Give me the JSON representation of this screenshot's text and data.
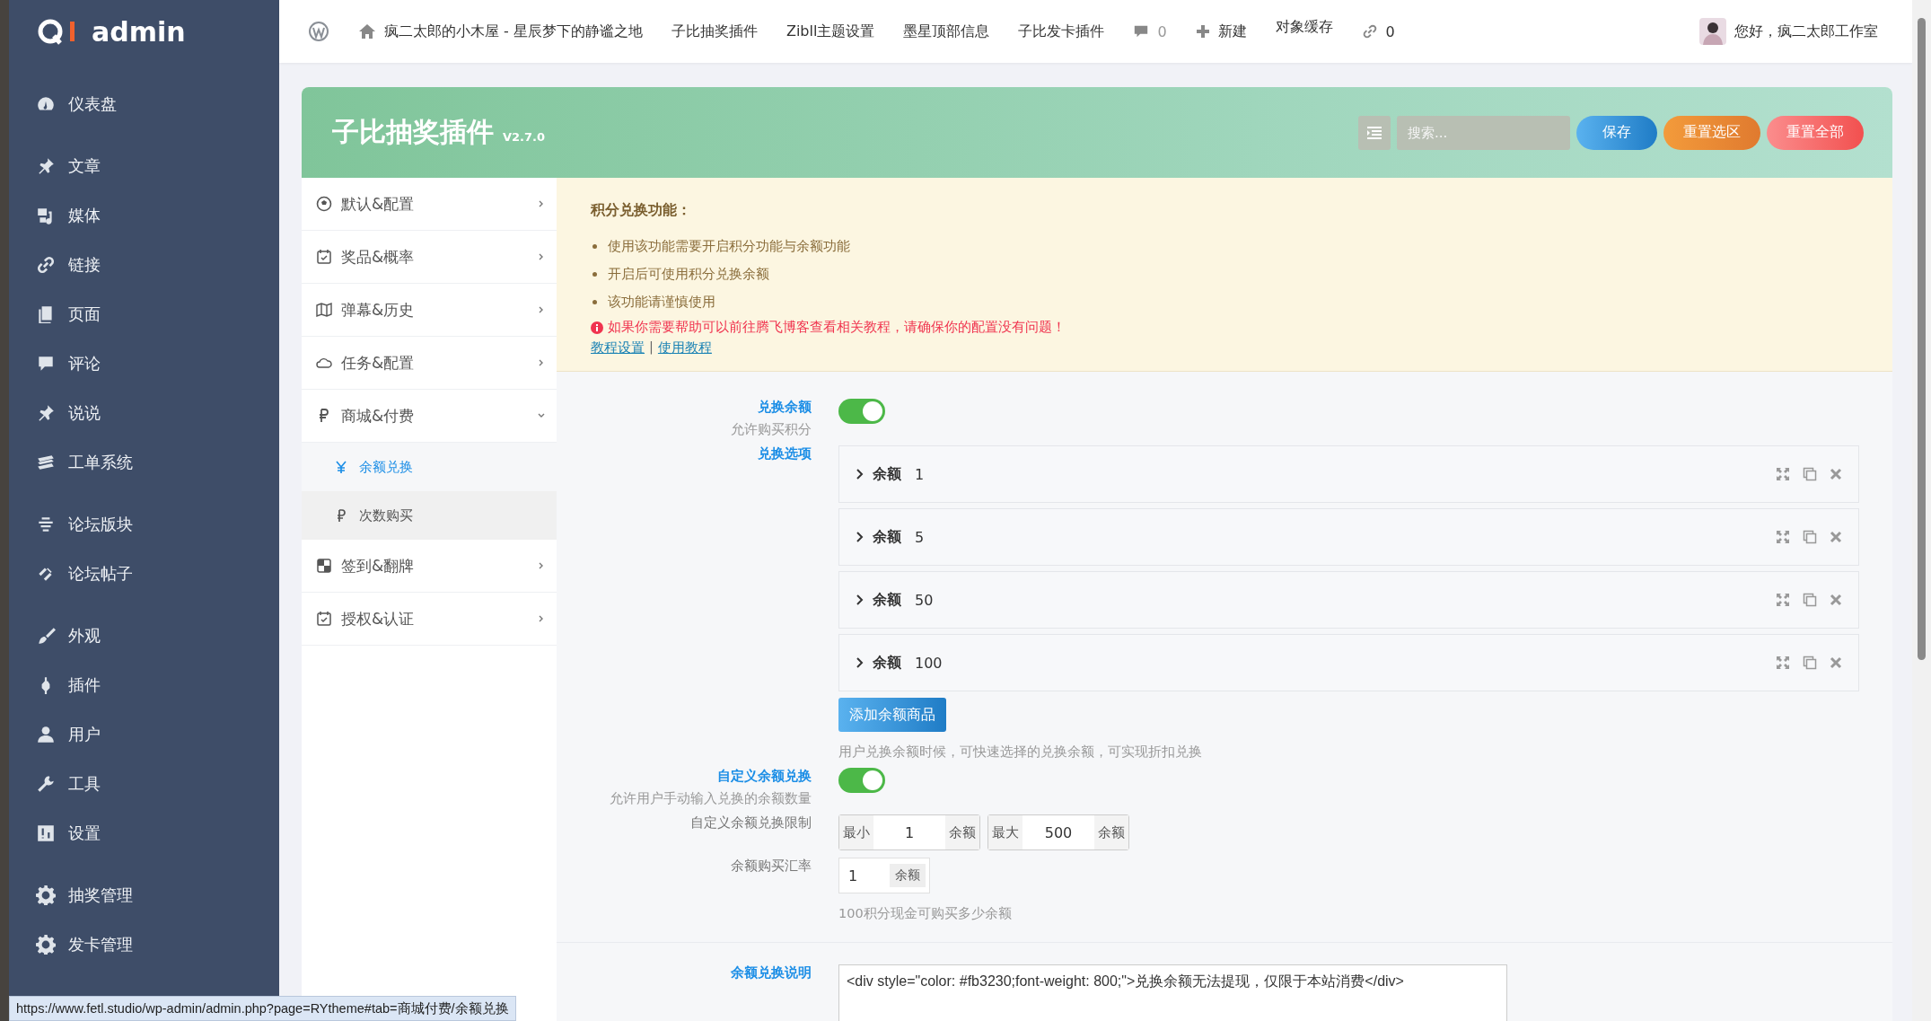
{
  "sidebar": {
    "logo": "admin",
    "items": [
      {
        "label": "仪表盘",
        "group_start": false
      },
      {
        "label": "文章",
        "group_start": true
      },
      {
        "label": "媒体",
        "group_start": false
      },
      {
        "label": "链接",
        "group_start": false
      },
      {
        "label": "页面",
        "group_start": false
      },
      {
        "label": "评论",
        "group_start": false
      },
      {
        "label": "说说",
        "group_start": false
      },
      {
        "label": "工单系统",
        "group_start": false
      },
      {
        "label": "论坛版块",
        "group_start": true
      },
      {
        "label": "论坛帖子",
        "group_start": false
      },
      {
        "label": "外观",
        "group_start": true
      },
      {
        "label": "插件",
        "group_start": false
      },
      {
        "label": "用户",
        "group_start": false
      },
      {
        "label": "工具",
        "group_start": false
      },
      {
        "label": "设置",
        "group_start": false
      },
      {
        "label": "抽奖管理",
        "group_start": true
      },
      {
        "label": "发卡管理",
        "group_start": false
      }
    ]
  },
  "top_bar": {
    "items": [
      {
        "kind": "icon"
      },
      {
        "kind": "site",
        "label": "疯二太郎的小木屋 - 星辰梦下的静谧之地"
      },
      {
        "kind": "text",
        "label": "子比抽奖插件"
      },
      {
        "kind": "text",
        "label": "Zibll主题设置"
      },
      {
        "kind": "text",
        "label": "墨星顶部信息"
      },
      {
        "kind": "text",
        "label": "子比发卡插件"
      },
      {
        "kind": "comments",
        "label": "0"
      },
      {
        "kind": "new",
        "label": "新建"
      },
      {
        "kind": "raised",
        "label": "对象缓存"
      },
      {
        "kind": "links",
        "label": "0"
      }
    ],
    "greeting": "您好，疯二太郎工作室"
  },
  "header": {
    "title": "子比抽奖插件",
    "version": "V2.7.0",
    "search": {
      "placeholder": "搜索..."
    },
    "buttons": [
      {
        "label": "保存",
        "kind": "save"
      },
      {
        "label": "重置选区",
        "kind": "reset-section"
      },
      {
        "label": "重置全部",
        "kind": "reset-all"
      }
    ]
  },
  "nav": [
    {
      "label": "默认&配置",
      "expanded": false
    },
    {
      "label": "奖品&概率",
      "expanded": false
    },
    {
      "label": "弹幕&历史",
      "expanded": false
    },
    {
      "label": "任务&配置",
      "expanded": false
    },
    {
      "label": "商城&付费",
      "expanded": true,
      "children": [
        {
          "label": "余额兑换",
          "selected": true
        },
        {
          "label": "次数购买",
          "selected": false
        }
      ]
    },
    {
      "label": "签到&翻牌",
      "expanded": false
    },
    {
      "label": "授权&认证",
      "expanded": false
    }
  ],
  "notice": {
    "title": "积分兑换功能：",
    "bullets": [
      "使用该功能需要开启积分功能与余额功能",
      "开启后可使用积分兑换余额",
      "该功能请谨慎使用"
    ],
    "warning": "如果你需要帮助可以前往腾飞博客查看相关教程，请确保你的配置没有问题！",
    "links": [
      "教程设置",
      "使用教程"
    ],
    "separator": "|"
  },
  "fields": [
    {
      "kind": "toggle",
      "label": "兑换余额",
      "subtitle": "允许购买积分",
      "on": true
    },
    {
      "kind": "repeater",
      "label": "兑换选项",
      "items": [
        {
          "label": "余额",
          "value": "1"
        },
        {
          "label": "余额",
          "value": "5"
        },
        {
          "label": "余额",
          "value": "50"
        },
        {
          "label": "余额",
          "value": "100"
        }
      ],
      "button": "添加余额商品",
      "help": "用户兑换余额时候，可快速选择的兑换余额，可实现折扣兑换"
    },
    {
      "kind": "toggle",
      "label": "自定义余额兑换",
      "subtitle": "允许用户手动输入兑换的余额数量",
      "on": true
    },
    {
      "kind": "range",
      "label": "自定义余额兑换限制",
      "min": {
        "prefix": "最小",
        "value": "1",
        "suffix": "余额"
      },
      "max": {
        "prefix": "最大",
        "value": "500",
        "suffix": "余额"
      }
    },
    {
      "kind": "number",
      "label": "余额购买汇率",
      "value": "1",
      "suffix": "余额",
      "help": "100积分现金可购买多少余额",
      "divider": true
    },
    {
      "kind": "code",
      "label": "余额兑换说明",
      "value": "<div style=\"color: #fb3230;font-weight: 800;\">兑换余额无法提现，仅限于本站消费</div>"
    }
  ],
  "status_url": "https://www.fetl.studio/wp-admin/admin.php?page=RYtheme#tab=商城付费/余额兑换"
}
